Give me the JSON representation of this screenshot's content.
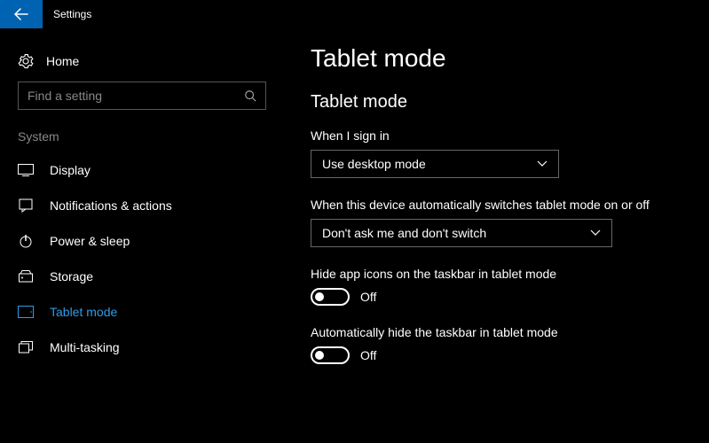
{
  "window": {
    "title": "Settings"
  },
  "sidebar": {
    "home_label": "Home",
    "search_placeholder": "Find a setting",
    "group_label": "System",
    "items": [
      {
        "label": "Display"
      },
      {
        "label": "Notifications & actions"
      },
      {
        "label": "Power & sleep"
      },
      {
        "label": "Storage"
      },
      {
        "label": "Tablet mode"
      },
      {
        "label": "Multi-tasking"
      }
    ],
    "active_index": 4
  },
  "content": {
    "page_title": "Tablet mode",
    "section_title": "Tablet mode",
    "signin": {
      "label": "When I sign in",
      "value": "Use desktop mode"
    },
    "autoswitch": {
      "label": "When this device automatically switches tablet mode on or off",
      "value": "Don't ask me and don't switch"
    },
    "hide_icons": {
      "label": "Hide app icons on the taskbar in tablet mode",
      "state_label": "Off",
      "on": false
    },
    "hide_taskbar": {
      "label": "Automatically hide the taskbar in tablet mode",
      "state_label": "Off",
      "on": false
    }
  }
}
